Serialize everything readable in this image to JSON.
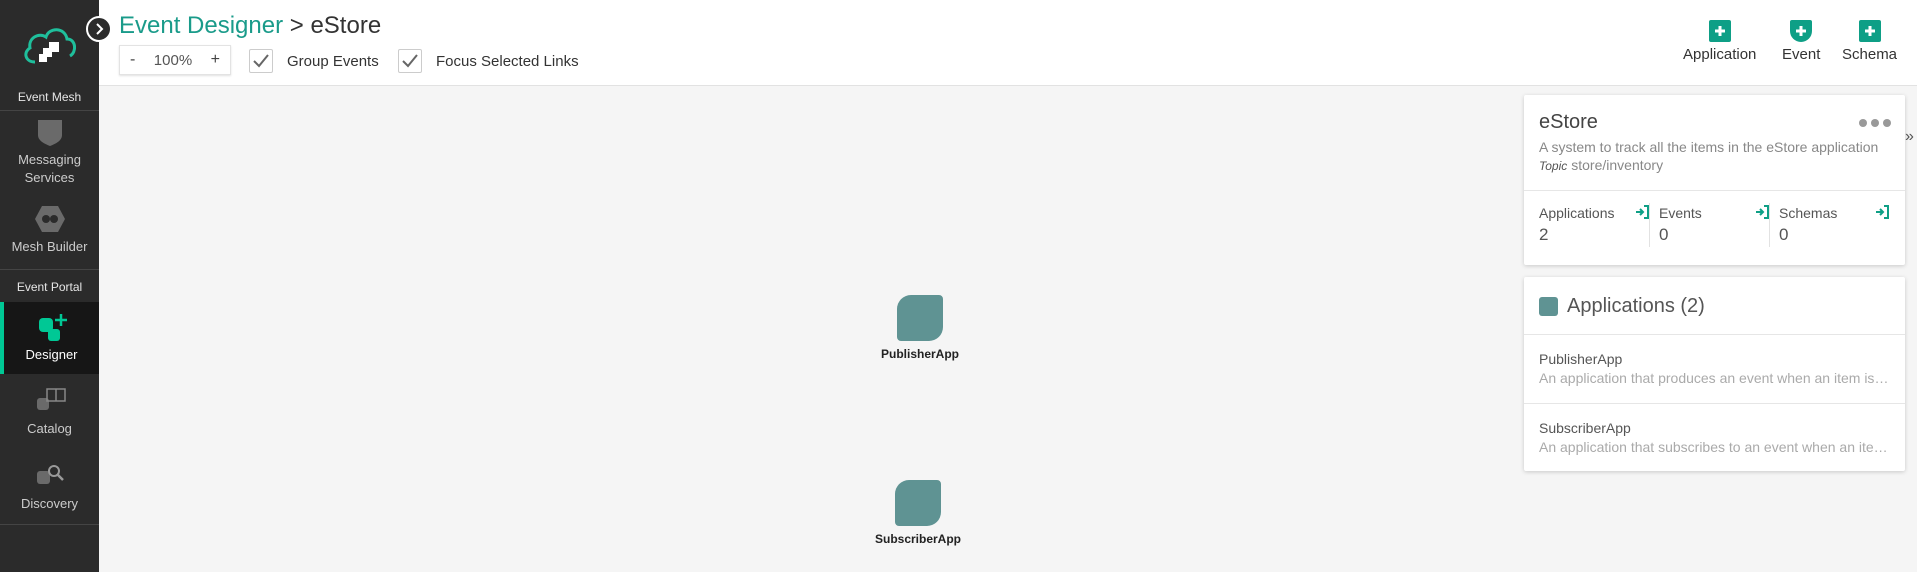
{
  "sidebar": {
    "event_mesh_label": "Event Mesh",
    "event_portal_label": "Event Portal",
    "items": [
      {
        "label": "Messaging Services",
        "icon": "shield-icon"
      },
      {
        "label": "Mesh Builder",
        "icon": "hexagon-icon"
      },
      {
        "label": "Designer",
        "icon": "designer-add-icon"
      },
      {
        "label": "Catalog",
        "icon": "catalog-icon"
      },
      {
        "label": "Discovery",
        "icon": "discovery-search-icon"
      }
    ]
  },
  "header": {
    "breadcrumb_root": "Event Designer",
    "breadcrumb_separator": ">",
    "breadcrumb_current": "eStore",
    "zoom": {
      "minus": "-",
      "value": "100%",
      "plus": "+"
    },
    "group_events_label": "Group Events",
    "focus_links_label": "Focus Selected Links",
    "add_buttons": [
      {
        "label": "Application",
        "icon": "add-application-icon"
      },
      {
        "label": "Event",
        "icon": "add-event-icon"
      },
      {
        "label": "Schema",
        "icon": "add-schema-icon"
      }
    ]
  },
  "canvas": {
    "nodes": [
      {
        "label": "PublisherApp"
      },
      {
        "label": "SubscriberApp"
      }
    ]
  },
  "domain_card": {
    "title": "eStore",
    "description": "A system to track all the items in the eStore application",
    "topic_label": "Topic",
    "topic_value": "store/inventory",
    "stats": [
      {
        "label": "Applications",
        "value": "2"
      },
      {
        "label": "Events",
        "value": "0"
      },
      {
        "label": "Schemas",
        "value": "0"
      }
    ]
  },
  "applications_card": {
    "title": "Applications (2)",
    "items": [
      {
        "name": "PublisherApp",
        "description": "An application that produces an event when an item is updated"
      },
      {
        "name": "SubscriberApp",
        "description": "An application that subscribes to an event when an item is updated"
      }
    ]
  },
  "colors": {
    "accent": "#0e9f86",
    "link": "#1a9b8a",
    "node": "#5f9393",
    "sidebar": "#2b2b2b"
  }
}
